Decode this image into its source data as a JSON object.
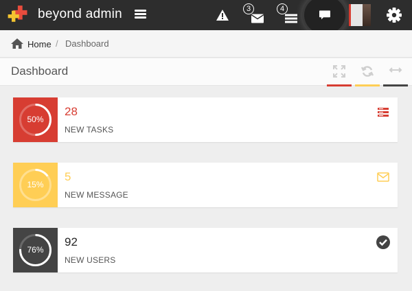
{
  "app": {
    "brand": "beyond admin"
  },
  "navbar": {
    "messages_count": "3",
    "tasks_count": "4"
  },
  "breadcrumb": {
    "home": "Home",
    "current": "Dashboard"
  },
  "page": {
    "title": "Dashboard"
  },
  "colors": {
    "red": "#d73d32",
    "yellow": "#ffce55",
    "dark": "#444444"
  },
  "cards": [
    {
      "percent": 50,
      "percent_label": "50%",
      "number": "28",
      "label": "NEW TASKS",
      "color": "#d73d32",
      "icon": "tasks-icon"
    },
    {
      "percent": 15,
      "percent_label": "15%",
      "number": "5",
      "label": "NEW MESSAGE",
      "color": "#ffce55",
      "icon": "envelope-icon"
    },
    {
      "percent": 76,
      "percent_label": "76%",
      "number": "92",
      "label": "NEW USERS",
      "color": "#444444",
      "icon": "check-circle-icon"
    }
  ]
}
